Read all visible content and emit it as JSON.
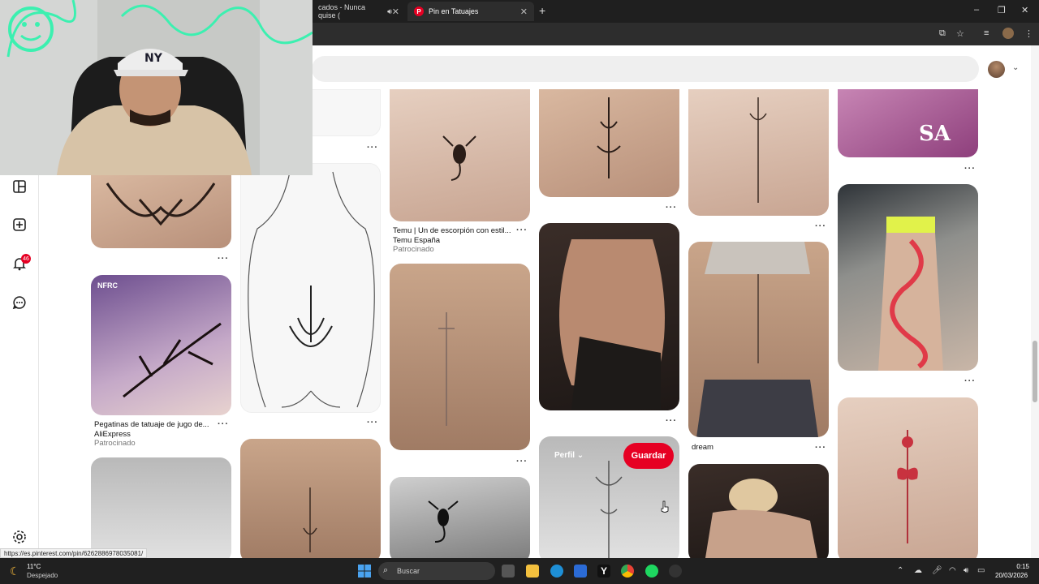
{
  "browser": {
    "tab_inactive": "cados - Nunca quise (",
    "tab_active": "Pin en Tatuajes",
    "new_tab": "+",
    "controls": [
      "–",
      "❐",
      "✕"
    ]
  },
  "sidebar": {
    "notifications_badge": "46"
  },
  "pins": [
    {
      "title": "Temu | Un de escorpión con estil...",
      "brand": "Temu España",
      "sponsored": "Patrocinado"
    },
    {
      "title": "Pegatinas de tatuaje de jugo de...",
      "brand": "AliExpress",
      "sponsored": "Patrocinado"
    },
    {
      "title": "dream"
    }
  ],
  "pin_image_text": {
    "nfrc_banner": "NFRC",
    "nails_monogram": "SA"
  },
  "hover": {
    "perfil": "Perfil",
    "save": "Guardar"
  },
  "more_label": "···",
  "status_url": "https://es.pinterest.com/pin/626288697803508​1/",
  "taskbar": {
    "weather_temp": "11°C",
    "weather_desc": "Despejado",
    "search_label": "Buscar",
    "time": "0:15",
    "date": "20/03/2026"
  }
}
